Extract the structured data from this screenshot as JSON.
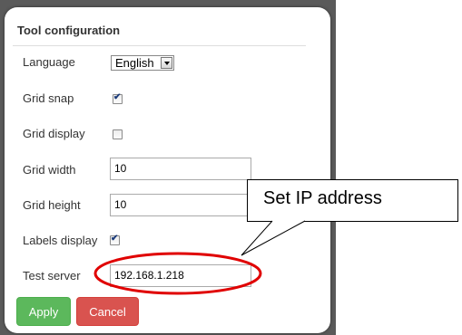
{
  "dialog": {
    "title": "Tool configuration",
    "rows": {
      "language": {
        "label": "Language",
        "value": "English"
      },
      "grid_snap": {
        "label": "Grid snap",
        "checked": true
      },
      "grid_display": {
        "label": "Grid display",
        "checked": false
      },
      "grid_width": {
        "label": "Grid width",
        "value": "10"
      },
      "grid_height": {
        "label": "Grid height",
        "value": "10"
      },
      "labels_display": {
        "label": "Labels display",
        "checked": true
      },
      "test_server": {
        "label": "Test server",
        "value": "192.168.1.218"
      }
    },
    "buttons": {
      "apply": "Apply",
      "cancel": "Cancel"
    }
  },
  "annotation": {
    "callout_text": "Set IP address",
    "highlight_color": "#e00000"
  },
  "colors": {
    "apply": "#5cb85c",
    "cancel": "#d9534f"
  },
  "icons": {
    "checkbox_check": "check-icon",
    "dropdown": "chevron-down-icon"
  }
}
